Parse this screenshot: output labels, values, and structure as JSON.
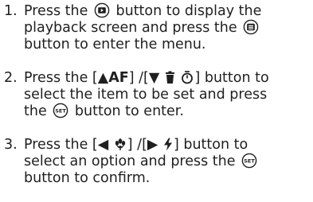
{
  "steps": [
    {
      "number": "1.",
      "lines": [
        {
          "pre": "Press the",
          "post": "button to display the"
        },
        {
          "pre": "playback screen and press the"
        },
        {
          "pre": "button to enter the menu."
        }
      ],
      "icons": [
        "playback-button-icon",
        "menu-button-icon"
      ]
    },
    {
      "number": "2.",
      "lines": [
        {
          "pre": "Press the [",
          "key1": "▲AF",
          "mid": "] /[",
          "key2": "▼",
          "post": "] button to"
        },
        {
          "pre": "select the item to be set and press"
        },
        {
          "pre": "the",
          "post": "button to enter."
        }
      ],
      "icons": [
        "up-af-icon",
        "down-delete-selftimer-icon",
        "set-button-icon"
      ]
    },
    {
      "number": "3.",
      "lines": [
        {
          "pre": "Press the [",
          "key1": "◀",
          "mid": "] /[",
          "key2": "▶",
          "post": "] button to"
        },
        {
          "pre": "select an option and press the"
        },
        {
          "pre": "button to confirm."
        }
      ],
      "icons": [
        "left-macro-icon",
        "right-flash-icon",
        "set-button-icon"
      ]
    }
  ]
}
